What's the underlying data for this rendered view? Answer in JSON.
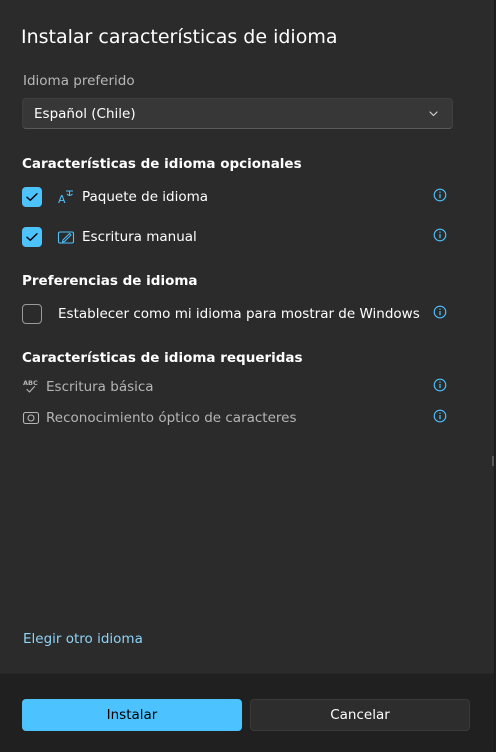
{
  "dialog": {
    "title": "Instalar características de idioma"
  },
  "preferred_language": {
    "label": "Idioma preferido",
    "selected": "Español (Chile)"
  },
  "optional_features": {
    "heading": "Características de idioma opcionales",
    "items": [
      {
        "label": "Paquete de idioma",
        "checked": true,
        "icon": "language-pack-icon"
      },
      {
        "label": "Escritura manual",
        "checked": true,
        "icon": "handwriting-icon"
      }
    ]
  },
  "language_preferences": {
    "heading": "Preferencias de idioma",
    "items": [
      {
        "label": "Establecer como mi idioma para mostrar de Windows",
        "checked": false
      }
    ]
  },
  "required_features": {
    "heading": "Características de idioma requeridas",
    "items": [
      {
        "label": "Escritura básica",
        "icon": "spellcheck-icon"
      },
      {
        "label": "Reconocimiento óptico de caracteres",
        "icon": "ocr-camera-icon"
      }
    ]
  },
  "links": {
    "choose_other": "Elegir otro idioma"
  },
  "footer": {
    "install_label": "Instalar",
    "cancel_label": "Cancelar"
  },
  "colors": {
    "accent": "#4cc2ff",
    "background": "#2b2b2b",
    "footer": "#202020",
    "link": "#8fd3f5"
  }
}
